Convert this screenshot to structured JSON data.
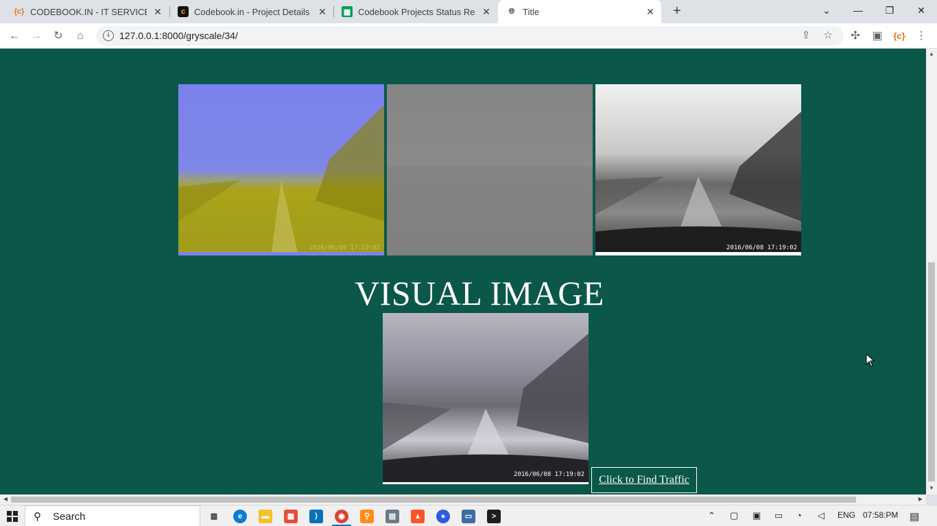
{
  "browser": {
    "tabs": [
      {
        "title": "CODEBOOK.IN - IT SERVICES",
        "icon": "codebook-icon",
        "active": false
      },
      {
        "title": "Codebook.in - Project Details",
        "icon": "codebook-dark-icon",
        "active": false
      },
      {
        "title": "Codebook Projects Status Report",
        "icon": "google-sheets-icon",
        "active": false
      },
      {
        "title": "Title",
        "icon": "globe-icon",
        "active": true
      }
    ],
    "url": "127.0.0.1:8000/gryscale/34/"
  },
  "page": {
    "thumbnails": [
      {
        "name": "tinted-image",
        "stamp": "2016/06/08 17:19:02"
      },
      {
        "name": "grayscale-image",
        "stamp": ""
      },
      {
        "name": "bw-image",
        "stamp": "2016/06/08 17:19:02"
      }
    ],
    "heading": "VISUAL IMAGE",
    "visual_stamp": "2016/06/08 17:19:02",
    "button_label": "Click to Find Traffic",
    "background_color": "#0b5749"
  },
  "taskbar": {
    "search_label": "Search",
    "language": "ENG",
    "time": "07:58:PM"
  }
}
